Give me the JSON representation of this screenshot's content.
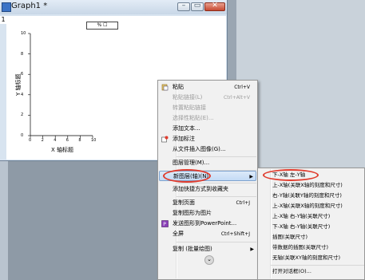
{
  "window": {
    "title": "Graph1 *",
    "layer_number": "1",
    "min": "–",
    "max": "▭",
    "close": "✕"
  },
  "plot": {
    "legend_text": "% ☐",
    "y_axis_label": "Y 轴标题",
    "x_axis_label": "X 轴标题",
    "y_ticks": [
      "10",
      "8",
      "6",
      "4",
      "2",
      "0"
    ],
    "x_ticks": [
      "0",
      "2",
      "4",
      "6",
      "8",
      "10"
    ]
  },
  "context_menu": {
    "items": [
      {
        "label": "粘贴",
        "shortcut": "Ctrl+V",
        "disabled": false,
        "icon": "paste-icon"
      },
      {
        "label": "粘贴链接(L)",
        "shortcut": "Ctrl+Alt+V",
        "disabled": true
      },
      {
        "label": "转置粘贴链接",
        "shortcut": "",
        "disabled": true
      },
      {
        "label": "选择性粘贴(E)...",
        "shortcut": "",
        "disabled": true
      },
      {
        "label": "添加文本...",
        "shortcut": "",
        "disabled": false
      },
      {
        "label": "添加标注",
        "shortcut": "",
        "disabled": false,
        "icon": "annotation-icon"
      },
      {
        "label": "从文件插入图像(G)...",
        "shortcut": "",
        "disabled": false
      },
      {
        "label": "图层管理(M)...",
        "shortcut": "",
        "disabled": false
      },
      {
        "label": "新图层(轴)(N)",
        "shortcut": "",
        "disabled": false,
        "submenu": true
      },
      {
        "label": "添加快捷方式到收藏夹",
        "shortcut": "",
        "disabled": false
      },
      {
        "label": "复制页面",
        "shortcut": "Ctrl+J",
        "disabled": false
      },
      {
        "label": "复制图形为图片",
        "shortcut": "",
        "disabled": false
      },
      {
        "label": "发送图形到PowerPoint...",
        "shortcut": "",
        "disabled": false,
        "icon": "powerpoint-icon"
      },
      {
        "label": "全屏",
        "shortcut": "Ctrl+Shift+J",
        "disabled": false
      },
      {
        "label": "复制 (批量绘图)",
        "shortcut": "",
        "disabled": false,
        "submenu": true
      }
    ],
    "more_arrow": "⌄"
  },
  "submenu": {
    "items": [
      "下-X轴 左-Y轴",
      "上-X轴(关联X轴的刻度和尺寸)",
      "右-Y轴(关联Y轴的刻度和尺寸)",
      "上-X轴(关联X轴的刻度和尺寸)",
      "上-X轴 右-Y轴(关联尺寸)",
      "下-X轴 右-Y轴(关联尺寸)",
      "插图(关联尺寸)",
      "带数据的插图(关联尺寸)",
      "无轴(关联XY轴的刻度和尺寸)",
      "打开对话框(O)..."
    ]
  },
  "colors": {
    "highlight": "#c3daf5",
    "annotation": "#e03c2e",
    "titlebar": "#c8d7e7"
  }
}
